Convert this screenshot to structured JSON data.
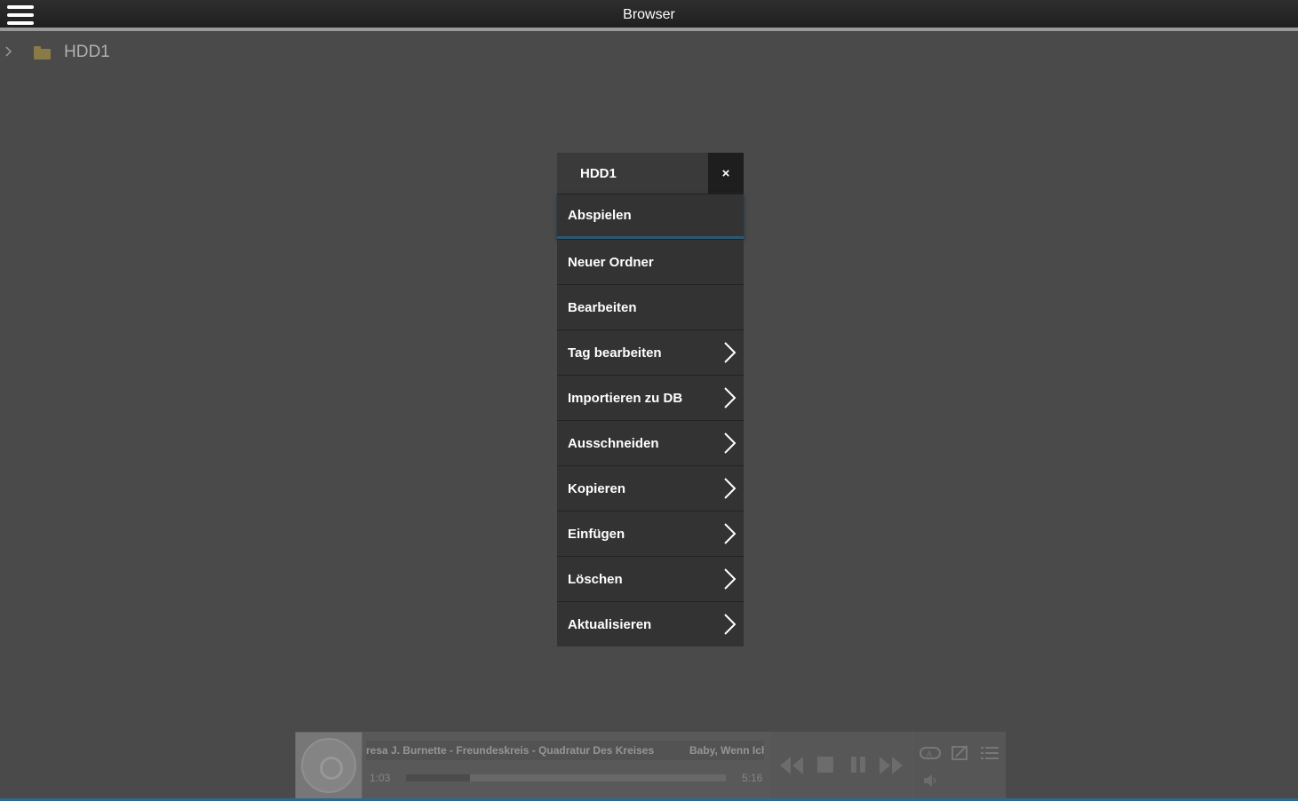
{
  "app": {
    "title": "Browser"
  },
  "tree": {
    "root_label": "HDD1"
  },
  "context_menu": {
    "title": "HDD1",
    "close_label": "×",
    "items": [
      {
        "label": "Abspielen",
        "has_submenu": false
      },
      {
        "label": "Neuer Ordner",
        "has_submenu": false
      },
      {
        "label": "Bearbeiten",
        "has_submenu": false
      },
      {
        "label": "Tag bearbeiten",
        "has_submenu": true
      },
      {
        "label": "Importieren zu DB",
        "has_submenu": true
      },
      {
        "label": "Ausschneiden",
        "has_submenu": true
      },
      {
        "label": "Kopieren",
        "has_submenu": true
      },
      {
        "label": "Einfügen",
        "has_submenu": true
      },
      {
        "label": "Löschen",
        "has_submenu": true
      },
      {
        "label": "Aktualisieren",
        "has_submenu": true
      }
    ]
  },
  "player": {
    "track_text": "resa J. Burnette - Freundeskreis - Quadratur Des Kreises",
    "next_text": "Baby, Wenn Ich",
    "time_current": "1:03",
    "time_total": "5:16",
    "progress_fraction": 0.2
  },
  "colors": {
    "accent": "#2c5872",
    "folder": "#8a7a48"
  }
}
